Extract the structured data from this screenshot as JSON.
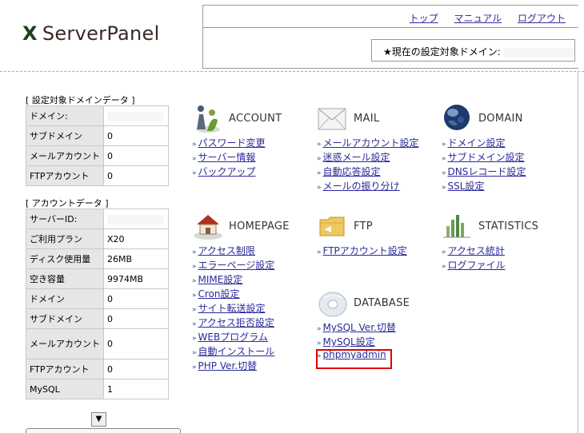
{
  "logo": {
    "mark": "X",
    "text": "ServerPanel"
  },
  "header": {
    "links": [
      "トップ",
      "マニュアル",
      "ログアウト"
    ],
    "current_domain_label": "★現在の設定対象ドメイン:",
    "current_domain_value": ""
  },
  "domain_data": {
    "title": "[ 設定対象ドメインデータ ]",
    "rows": [
      {
        "key": "ドメイン:",
        "value": ""
      },
      {
        "key": "サブドメイン",
        "value": "0"
      },
      {
        "key": "メールアカウント",
        "value": "0"
      },
      {
        "key": "FTPアカウント",
        "value": "0"
      }
    ]
  },
  "account_data": {
    "title": "[ アカウントデータ ]",
    "rows": [
      {
        "key": "サーバーID:",
        "value": ""
      },
      {
        "key": "ご利用プラン",
        "value": "X20"
      },
      {
        "key": "ディスク使用量",
        "value": "26MB"
      },
      {
        "key": "空き容量",
        "value": "9974MB"
      },
      {
        "key": "ドメイン",
        "value": "0"
      },
      {
        "key": "サブドメイン",
        "value": "0"
      },
      {
        "key": "メールアカウント",
        "value": "0"
      },
      {
        "key": "FTPアカウント",
        "value": "0"
      },
      {
        "key": "MySQL",
        "value": "1"
      }
    ]
  },
  "groups": {
    "account": {
      "title": "ACCOUNT",
      "icon": "account-icon",
      "items": [
        "パスワード変更",
        "サーバー情報",
        "バックアップ"
      ]
    },
    "mail": {
      "title": "MAIL",
      "icon": "mail-icon",
      "items": [
        "メールアカウント設定",
        "迷惑メール設定",
        "自動応答設定",
        "メールの振り分け"
      ]
    },
    "domain": {
      "title": "DOMAIN",
      "icon": "globe-icon",
      "items": [
        "ドメイン設定",
        "サブドメイン設定",
        "DNSレコード設定",
        "SSL設定"
      ]
    },
    "homepage": {
      "title": "HOMEPAGE",
      "icon": "house-icon",
      "items": [
        "アクセス制限",
        "エラーページ設定",
        "MIME設定",
        "Cron設定",
        "サイト転送設定",
        "アクセス拒否設定",
        "WEBプログラム",
        "自動インストール",
        "PHP Ver.切替"
      ]
    },
    "ftp": {
      "title": "FTP",
      "icon": "folder-icon",
      "items": [
        "FTPアカウント設定"
      ]
    },
    "statistics": {
      "title": "STATISTICS",
      "icon": "chart-icon",
      "items": [
        "アクセス統計",
        "ログファイル"
      ]
    },
    "database": {
      "title": "DATABASE",
      "icon": "disc-icon",
      "items": [
        "MySQL Ver.切替",
        "MySQL設定",
        "phpmyadmin"
      ]
    }
  }
}
